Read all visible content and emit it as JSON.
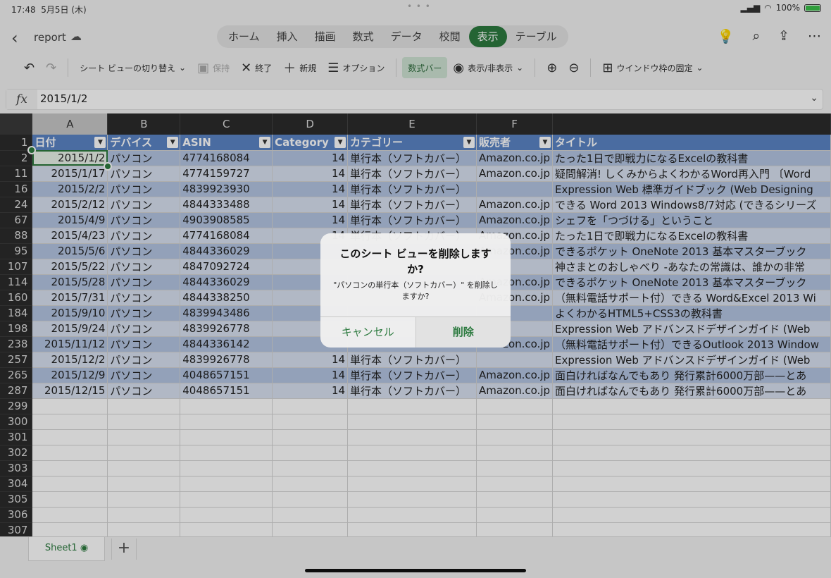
{
  "status": {
    "time": "17:48",
    "date": "5月5日 (木)",
    "battery": "100%"
  },
  "app": {
    "doc_title": "report"
  },
  "ribbon_tabs": [
    "ホーム",
    "挿入",
    "描画",
    "数式",
    "データ",
    "校閲",
    "表示",
    "テーブル"
  ],
  "active_tab": "表示",
  "toolbar": {
    "sheet_view": "シート ビューの切り替え",
    "save": "保持",
    "exit": "終了",
    "new": "新規",
    "options": "オプション",
    "formula_bar": "数式バー",
    "show_hide": "表示/非表示",
    "freeze": "ウインドウ枠の固定"
  },
  "formula_bar": {
    "value": "2015/1/2"
  },
  "columns": [
    "A",
    "B",
    "C",
    "D",
    "E",
    "F"
  ],
  "table_headers": [
    "日付",
    "デバイス",
    "ASIN",
    "Category",
    "カテゴリー",
    "販売者",
    "タイトル"
  ],
  "rows": [
    {
      "row": "2",
      "date": "2015/1/2",
      "device": "パソコン",
      "asin": "4774168084",
      "cat": "14",
      "catname": "単行本（ソフトカバー）",
      "seller": "Amazon.co.jp",
      "title": "たった1日で即戦力になるExcelの教科書"
    },
    {
      "row": "11",
      "date": "2015/1/17",
      "device": "パソコン",
      "asin": "4774159727",
      "cat": "14",
      "catname": "単行本（ソフトカバー）",
      "seller": "Amazon.co.jp",
      "title": "疑問解消! しくみからよくわかるWord再入門 〔Word"
    },
    {
      "row": "16",
      "date": "2015/2/2",
      "device": "パソコン",
      "asin": "4839923930",
      "cat": "14",
      "catname": "単行本（ソフトカバー）",
      "seller": "",
      "title": "Expression Web 標準ガイドブック (Web Designing"
    },
    {
      "row": "24",
      "date": "2015/2/12",
      "device": "パソコン",
      "asin": "4844333488",
      "cat": "14",
      "catname": "単行本（ソフトカバー）",
      "seller": "Amazon.co.jp",
      "title": "できる Word 2013 Windows8/7対応 (できるシリーズ"
    },
    {
      "row": "67",
      "date": "2015/4/9",
      "device": "パソコン",
      "asin": "4903908585",
      "cat": "14",
      "catname": "単行本（ソフトカバー）",
      "seller": "Amazon.co.jp",
      "title": "シェフを「つづける」ということ"
    },
    {
      "row": "88",
      "date": "2015/4/23",
      "device": "パソコン",
      "asin": "4774168084",
      "cat": "14",
      "catname": "単行本（ソフトカバー）",
      "seller": "Amazon.co.jp",
      "title": "たった1日で即戦力になるExcelの教科書"
    },
    {
      "row": "95",
      "date": "2015/5/6",
      "device": "パソコン",
      "asin": "4844336029",
      "cat": "",
      "catname": "",
      "seller": "Amazon.co.jp",
      "title": "できるポケット OneNote 2013 基本マスターブック"
    },
    {
      "row": "107",
      "date": "2015/5/22",
      "device": "パソコン",
      "asin": "4847092724",
      "cat": "",
      "catname": "",
      "seller": "",
      "title": "神さまとのおしゃべり -あなたの常識は、誰かの非常"
    },
    {
      "row": "114",
      "date": "2015/5/28",
      "device": "パソコン",
      "asin": "4844336029",
      "cat": "",
      "catname": "",
      "seller": "Amazon.co.jp",
      "title": "できるポケット OneNote 2013 基本マスターブック"
    },
    {
      "row": "160",
      "date": "2015/7/31",
      "device": "パソコン",
      "asin": "4844338250",
      "cat": "",
      "catname": "",
      "seller": "Amazon.co.jp",
      "title": "（無料電話サポート付）できる Word&Excel 2013 Wi"
    },
    {
      "row": "184",
      "date": "2015/9/10",
      "device": "パソコン",
      "asin": "4839943486",
      "cat": "",
      "catname": "",
      "seller": "",
      "title": "よくわかるHTML5+CSS3の教科書"
    },
    {
      "row": "198",
      "date": "2015/9/24",
      "device": "パソコン",
      "asin": "4839926778",
      "cat": "",
      "catname": "",
      "seller": "",
      "title": "Expression Web アドバンスドデザインガイド (Web"
    },
    {
      "row": "238",
      "date": "2015/11/12",
      "device": "パソコン",
      "asin": "4844336142",
      "cat": "",
      "catname": "",
      "seller": "Amazon.co.jp",
      "title": "（無料電話サポート付）できるOutlook 2013 Window"
    },
    {
      "row": "257",
      "date": "2015/12/2",
      "device": "パソコン",
      "asin": "4839926778",
      "cat": "14",
      "catname": "単行本（ソフトカバー）",
      "seller": "",
      "title": "Expression Web アドバンスドデザインガイド (Web"
    },
    {
      "row": "265",
      "date": "2015/12/9",
      "device": "パソコン",
      "asin": "4048657151",
      "cat": "14",
      "catname": "単行本（ソフトカバー）",
      "seller": "Amazon.co.jp",
      "title": "面白ければなんでもあり 発行累計6000万部——とあ"
    },
    {
      "row": "287",
      "date": "2015/12/15",
      "device": "パソコン",
      "asin": "4048657151",
      "cat": "14",
      "catname": "単行本（ソフトカバー）",
      "seller": "Amazon.co.jp",
      "title": "面白ければなんでもあり 発行累計6000万部——とあ"
    }
  ],
  "empty_rows": [
    "299",
    "300",
    "301",
    "302",
    "303",
    "304",
    "305",
    "306",
    "307"
  ],
  "header_row": "1",
  "dialog": {
    "title": "このシート ビューを削除しますか?",
    "message": "\"パソコンの単行本（ソフトカバー）\" を削除しますか?",
    "cancel": "キャンセル",
    "delete": "削除"
  },
  "sheet_tab": "Sheet1",
  "colors": {
    "accent": "#2c7a3f",
    "table_header": "#5b84c5",
    "band_dark": "#b4c5e2",
    "band_light": "#d8e1f1"
  }
}
